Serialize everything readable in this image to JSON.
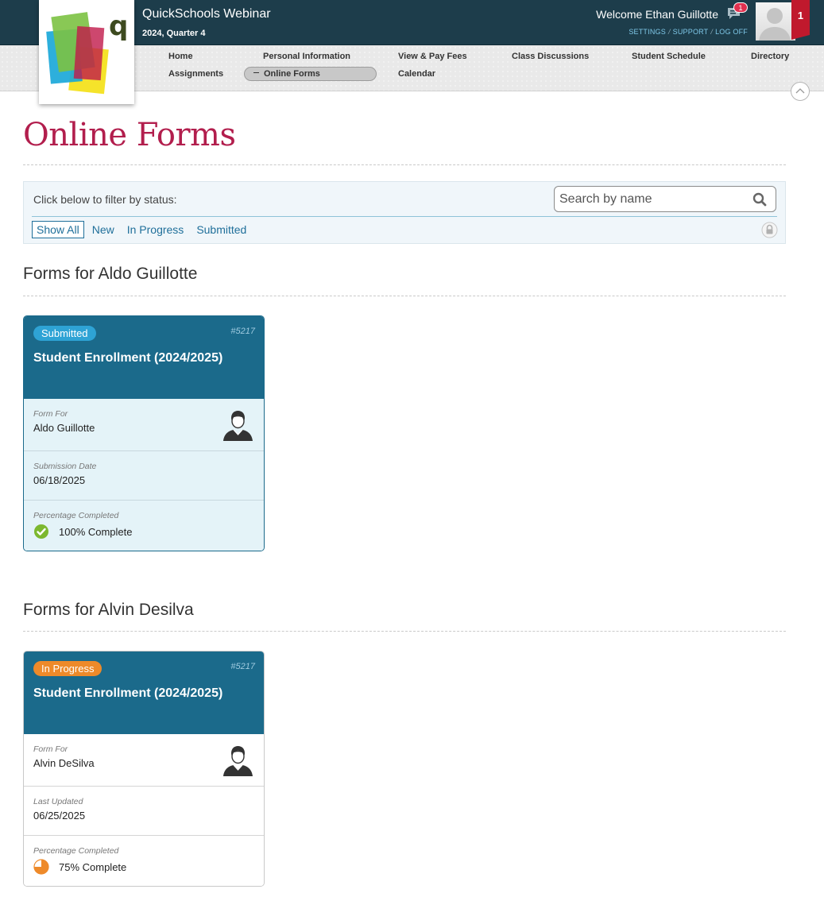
{
  "header": {
    "school_name": "QuickSchools Webinar",
    "term": "2024, Quarter 4",
    "welcome": "Welcome Ethan Guillotte",
    "message_count": "1",
    "links": {
      "settings": "SETTINGS",
      "support": "SUPPORT",
      "logoff": "LOG OFF"
    },
    "notification_count": "1"
  },
  "nav": {
    "home": "Home",
    "personal_information": "Personal Information",
    "view_pay_fees": "View & Pay Fees",
    "class_discussions": "Class Discussions",
    "student_schedule": "Student Schedule",
    "directory": "Directory",
    "assignments": "Assignments",
    "online_forms": "Online Forms",
    "calendar": "Calendar"
  },
  "page": {
    "title": "Online Forms"
  },
  "filter": {
    "label": "Click below to filter by status:",
    "search_placeholder": "Search by name",
    "tabs": [
      "Show All",
      "New",
      "In Progress",
      "Submitted"
    ],
    "active_tab": "Show All"
  },
  "sections": [
    {
      "title": "Forms for Aldo Guillotte",
      "card": {
        "status": "Submitted",
        "form_id": "#5217",
        "title": "Student Enrollment (2024/2025)",
        "form_for_label": "Form For",
        "form_for": "Aldo Guillotte",
        "date_label": "Submission Date",
        "date": "06/18/2025",
        "pct_label": "Percentage Completed",
        "pct_text": "100% Complete",
        "pct_value": 1.0
      }
    },
    {
      "title": "Forms for Alvin Desilva",
      "card": {
        "status": "In Progress",
        "form_id": "#5217",
        "title": "Student Enrollment (2024/2025)",
        "form_for_label": "Form For",
        "form_for": "Alvin DeSilva",
        "date_label": "Last Updated",
        "date": "06/25/2025",
        "pct_label": "Percentage Completed",
        "pct_text": "75% Complete",
        "pct_value": 0.75
      }
    }
  ],
  "colors": {
    "header_bg": "#1d3d4b",
    "title_accent": "#b21e4d",
    "card_head": "#1b6a8b",
    "badge_submitted": "#2ea3d5",
    "badge_in_progress": "#ee8a2a",
    "complete_green": "#7cb82f"
  }
}
